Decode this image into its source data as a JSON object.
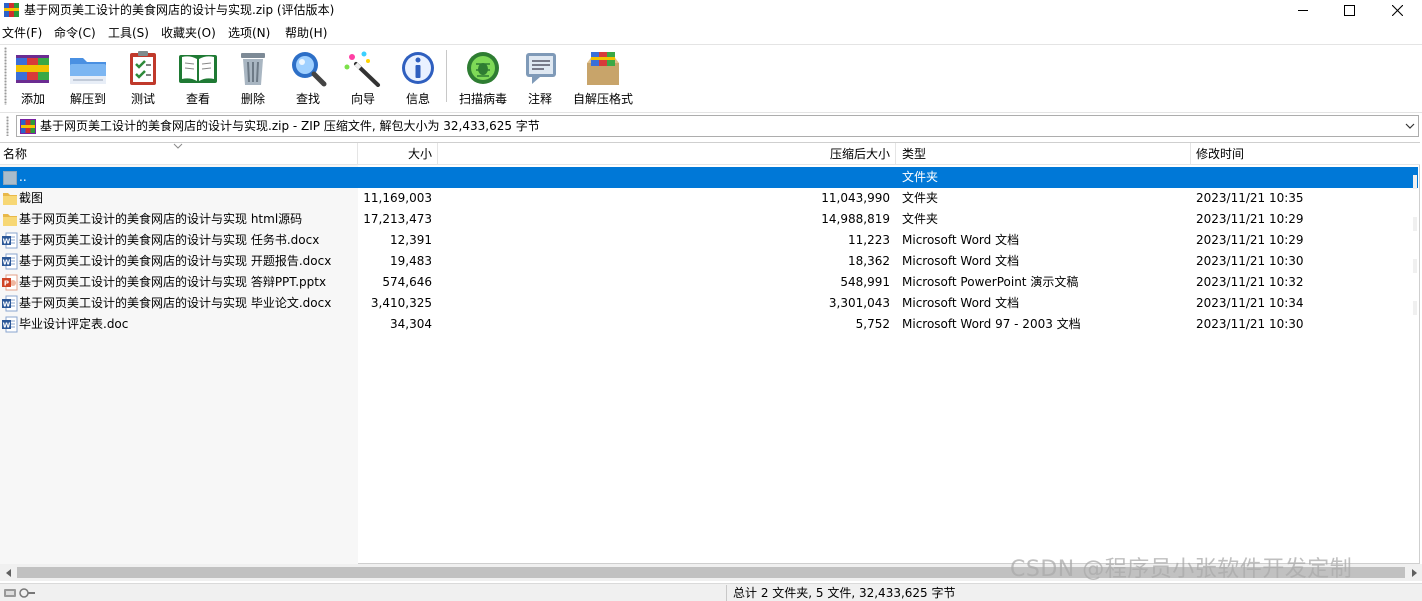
{
  "window": {
    "title": "基于网页美工设计的美食网店的设计与实现.zip (评估版本)"
  },
  "menu": [
    "文件(F)",
    "命令(C)",
    "工具(S)",
    "收藏夹(O)",
    "选项(N)",
    "帮助(H)"
  ],
  "toolbar": {
    "add": "添加",
    "extract_to": "解压到",
    "test": "测试",
    "view": "查看",
    "delete": "删除",
    "find": "查找",
    "wizard": "向导",
    "info": "信息",
    "virus_scan": "扫描病毒",
    "comment": "注释",
    "sfx": "自解压格式"
  },
  "address": {
    "text": "基于网页美工设计的美食网店的设计与实现.zip - ZIP 压缩文件, 解包大小为 32,433,625 字节"
  },
  "columns": {
    "name": "名称",
    "size": "大小",
    "packed": "压缩后大小",
    "type": "类型",
    "modified": "修改时间"
  },
  "rows": [
    {
      "icon": "parent-folder-icon",
      "name": "..",
      "size": "",
      "packed": "",
      "type": "文件夹",
      "modified": "",
      "selected": true
    },
    {
      "icon": "folder-icon",
      "name": "截图",
      "size": "11,169,003",
      "packed": "11,043,990",
      "type": "文件夹",
      "modified": "2023/11/21 10:35"
    },
    {
      "icon": "folder-icon",
      "name": "基于网页美工设计的美食网店的设计与实现 html源码",
      "size": "17,213,473",
      "packed": "14,988,819",
      "type": "文件夹",
      "modified": "2023/11/21 10:29"
    },
    {
      "icon": "word-doc-icon",
      "name": "基于网页美工设计的美食网店的设计与实现 任务书.docx",
      "size": "12,391",
      "packed": "11,223",
      "type": "Microsoft Word 文档",
      "modified": "2023/11/21 10:29"
    },
    {
      "icon": "word-doc-icon",
      "name": "基于网页美工设计的美食网店的设计与实现 开题报告.docx",
      "size": "19,483",
      "packed": "18,362",
      "type": "Microsoft Word 文档",
      "modified": "2023/11/21 10:30"
    },
    {
      "icon": "powerpoint-icon",
      "name": "基于网页美工设计的美食网店的设计与实现  答辩PPT.pptx",
      "size": "574,646",
      "packed": "548,991",
      "type": "Microsoft PowerPoint 演示文稿",
      "modified": "2023/11/21 10:32"
    },
    {
      "icon": "word-doc-icon",
      "name": "基于网页美工设计的美食网店的设计与实现  毕业论文.docx",
      "size": "3,410,325",
      "packed": "3,301,043",
      "type": "Microsoft Word 文档",
      "modified": "2023/11/21 10:34"
    },
    {
      "icon": "word-doc-icon",
      "name": "毕业设计评定表.doc",
      "size": "34,304",
      "packed": "5,752",
      "type": "Microsoft Word 97 - 2003 文档",
      "modified": "2023/11/21 10:30"
    }
  ],
  "status": {
    "summary": "总计 2 文件夹, 5 文件, 32,433,625 字节"
  },
  "watermark": "CSDN @程序员小张软件开发定制",
  "colors": {
    "selection": "#0078d7",
    "name_column_bg": "#f7f7f7"
  }
}
